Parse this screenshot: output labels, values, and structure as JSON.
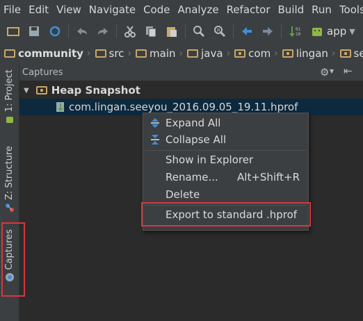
{
  "menu": [
    "File",
    "Edit",
    "View",
    "Navigate",
    "Code",
    "Analyze",
    "Refactor",
    "Build",
    "Run",
    "Tools"
  ],
  "toolbar": {
    "app_config": "app"
  },
  "breadcrumb": [
    "community",
    "src",
    "main",
    "java",
    "com",
    "lingan",
    "se"
  ],
  "sidebar": {
    "project": "1: Project",
    "structure": "Z: Structure",
    "captures": "Captures"
  },
  "panel": {
    "title": "Captures"
  },
  "tree": {
    "group": "Heap Snapshot",
    "file": "com.lingan.seeyou_2016.09.05_19.11.hprof"
  },
  "context_menu": {
    "expand_all": "Expand All",
    "collapse_all": "Collapse All",
    "show_in_explorer": "Show in Explorer",
    "rename": "Rename...",
    "rename_shortcut": "Alt+Shift+R",
    "delete": "Delete",
    "export": "Export to standard .hprof"
  },
  "colors": {
    "highlight_box": "#d7373d",
    "selection": "#0d293e",
    "folder": "#c9a869"
  }
}
